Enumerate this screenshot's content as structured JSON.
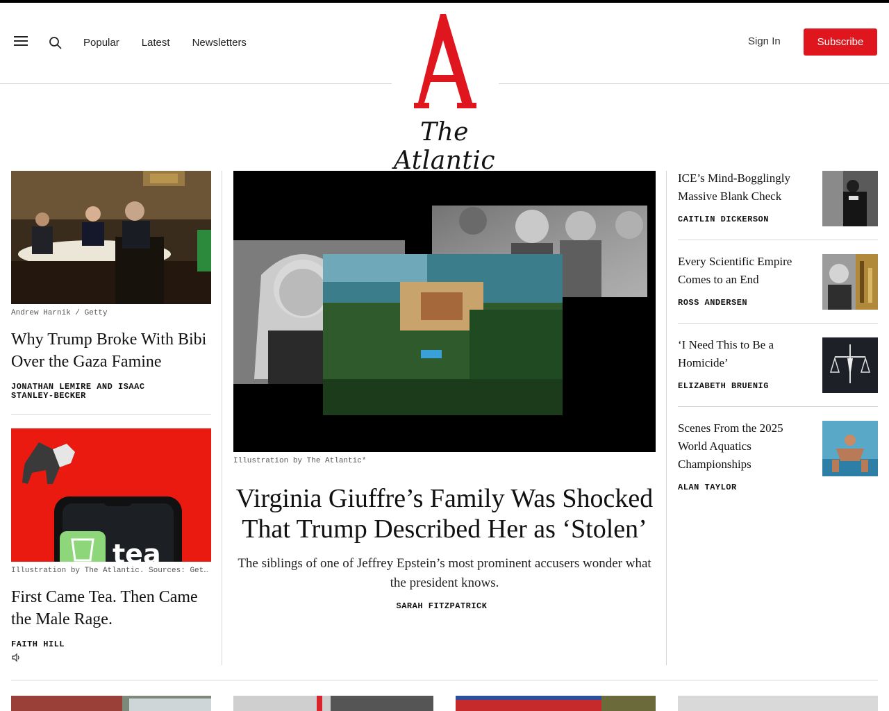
{
  "header": {
    "nav": [
      "Popular",
      "Latest",
      "Newsletters"
    ],
    "logo_letter": "A",
    "logo_text": "The Atlantic",
    "signin": "Sign In",
    "subscribe": "Subscribe"
  },
  "left": [
    {
      "credit": "Andrew Harnik / Getty",
      "headline": "Why Trump Broke With Bibi Over the Gaza Famine",
      "byline": "JONATHAN LEMIRE AND ISAAC STANLEY-BECKER"
    },
    {
      "credit": "Illustration by The Atlantic. Sources: Getty",
      "headline": "First Came Tea. Then Came the Male Rage.",
      "byline": "FAITH HILL",
      "image_label": "tea"
    }
  ],
  "main": {
    "credit": "Illustration by The Atlantic*",
    "headline": "Virginia Giuffre’s Family Was Shocked That Trump Described Her as ‘Stolen’",
    "dek": "The siblings of one of Jeffrey Epstein’s most prominent accusers wonder what the president knows.",
    "byline": "SARAH FITZPATRICK"
  },
  "right": [
    {
      "headline": "ICE’s Mind-Bogglingly Massive Blank Check",
      "byline": "CAITLIN DICKERSON"
    },
    {
      "headline": "Every Scientific Empire Comes to an End",
      "byline": "ROSS ANDERSEN"
    },
    {
      "headline": "‘I Need This to Be a Homicide’",
      "byline": "ELIZABETH BRUENIG"
    },
    {
      "headline": "Scenes From the 2025 World Aquatics Championships",
      "byline": "ALAN TAYLOR"
    }
  ],
  "colors": {
    "brand_red": "#e0161e"
  }
}
